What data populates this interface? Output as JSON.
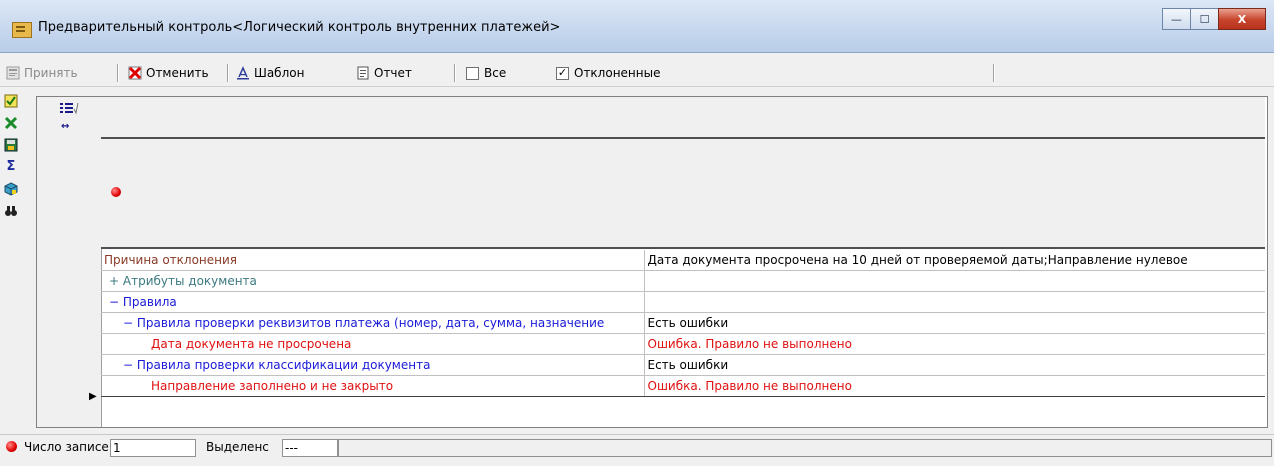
{
  "window": {
    "title": "Предварительный контроль<Логический контроль внутренних платежей>",
    "minimize": "—",
    "maximize": "☐",
    "close": "X"
  },
  "toolbar": {
    "accept_label": "Принять",
    "cancel_label": "Отменить",
    "template_label": "Шаблон",
    "report_label": "Отчет",
    "all_label": "Все",
    "all_checked": false,
    "rejected_label": "Отклоненные",
    "rejected_checked": true
  },
  "side_icons": [
    "check-list-icon",
    "excel-icon",
    "save-icon",
    "sum-icon",
    "cube-icon",
    "binoculars-icon"
  ],
  "grid": {
    "rows": [
      {
        "label": "Причина отклонения",
        "value": "Дата документа просрочена на 10 дней от проверяемой даты;Направление нулевое"
      },
      {
        "label": "Атрибуты документа",
        "value": ""
      },
      {
        "label": "Правила",
        "value": ""
      },
      {
        "label": "Правила проверки реквизитов платежа (номер, дата, сумма, назначение",
        "value": "Есть ошибки"
      },
      {
        "label": "Дата документа не просрочена",
        "value": "Ошибка. Правило не выполнено"
      },
      {
        "label": "Правила проверки классификации документа",
        "value": "Есть ошибки"
      },
      {
        "label": "Направление заполнено и не закрыто",
        "value": "Ошибка. Правило не выполнено"
      }
    ]
  },
  "status": {
    "records_label": "Число записе",
    "records_value": "1",
    "selected_label": "Выделенс",
    "selected_value": "---"
  },
  "colors": {
    "error_red": "#e01010",
    "link_blue": "#1a1ad8",
    "header_brown": "#8a3a26",
    "teal": "#3a7a80"
  }
}
